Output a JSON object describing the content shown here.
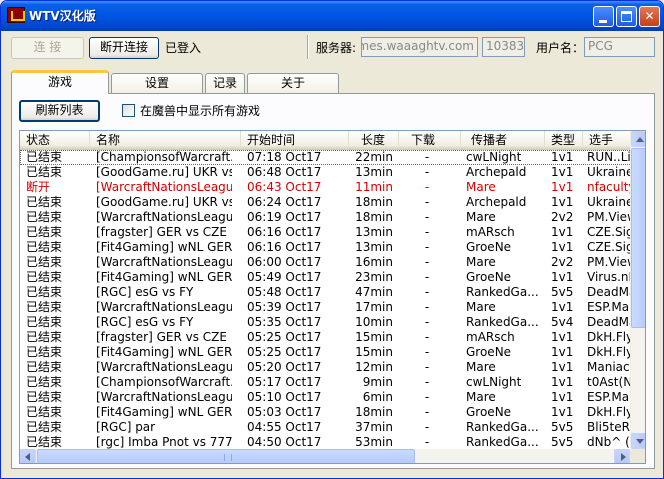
{
  "window": {
    "title": "WTV汉化版"
  },
  "toolbar": {
    "connect_label": "连 接",
    "disconnect_label": "断开连接",
    "status_text": "已登入",
    "server_label": "服务器:",
    "server_value": "games.waaaghtv.com",
    "port_value": "10383",
    "username_label": "用户名：",
    "username_value": "PCG"
  },
  "tabs": [
    {
      "label": "游戏"
    },
    {
      "label": "设置"
    },
    {
      "label": "记录"
    },
    {
      "label": "关于"
    }
  ],
  "games_tab": {
    "refresh_label": "刷新列表",
    "show_all_label": "在魔兽中显示所有游戏",
    "show_all_checked": false
  },
  "table": {
    "columns": [
      "状态",
      "名称",
      "开始时间",
      "长度",
      "下载",
      "传播者",
      "类型",
      "选手"
    ],
    "rows": [
      {
        "status": "已结束",
        "name": "[ChampionsofWarcraft...",
        "time": "07:18 Oct17",
        "length": "22min",
        "download": "-",
        "caster": "cwLNight",
        "type": "1v1",
        "players": "RUN..Lin",
        "selected": true,
        "red": false
      },
      {
        "status": "已结束",
        "name": "[GoodGame.ru] UKR vs...",
        "time": "06:48 Oct17",
        "length": "13min",
        "download": "-",
        "caster": "Archepald",
        "type": "1v1",
        "players": "Ukraine.",
        "selected": false,
        "red": false
      },
      {
        "status": "断开",
        "name": "[WarcraftNationsLeagu...",
        "time": "06:43 Oct17",
        "length": "11min",
        "download": "-",
        "caster": "Mare",
        "type": "1v1",
        "players": "nfaculty",
        "selected": false,
        "red": true
      },
      {
        "status": "已结束",
        "name": "[GoodGame.ru] UKR vs...",
        "time": "06:24 Oct17",
        "length": "18min",
        "download": "-",
        "caster": "Archepald",
        "type": "1v1",
        "players": "Ukraine.",
        "selected": false,
        "red": false
      },
      {
        "status": "已结束",
        "name": "[WarcraftNationsLeagu...",
        "time": "06:19 Oct17",
        "length": "18min",
        "download": "-",
        "caster": "Mare",
        "type": "2v2",
        "players": "PM.View",
        "selected": false,
        "red": false
      },
      {
        "status": "已结束",
        "name": "[fragster] GER vs CZE",
        "time": "06:16 Oct17",
        "length": "13min",
        "download": "-",
        "caster": "mARsch",
        "type": "1v1",
        "players": "CZE.Sign",
        "selected": false,
        "red": false
      },
      {
        "status": "已结束",
        "name": "[Fit4Gaming] wNL GER...",
        "time": "06:16 Oct17",
        "length": "13min",
        "download": "-",
        "caster": "GroeNe",
        "type": "1v1",
        "players": "CZE.Sign",
        "selected": false,
        "red": false
      },
      {
        "status": "已结束",
        "name": "[WarcraftNationsLeagu...",
        "time": "06:00 Oct17",
        "length": "16min",
        "download": "-",
        "caster": "Mare",
        "type": "2v2",
        "players": "PM.View",
        "selected": false,
        "red": false
      },
      {
        "status": "已结束",
        "name": "[Fit4Gaming] wNL GER...",
        "time": "05:49 Oct17",
        "length": "23min",
        "download": "-",
        "caster": "GroeNe",
        "type": "1v1",
        "players": "Virus.nE",
        "selected": false,
        "red": false
      },
      {
        "status": "已结束",
        "name": "[RGC] esG vs FY",
        "time": "05:48 Oct17",
        "length": "47min",
        "download": "-",
        "caster": "RankedGa...",
        "type": "5v5",
        "players": "DeadMa",
        "selected": false,
        "red": false
      },
      {
        "status": "已结束",
        "name": "[WarcraftNationsLeagu...",
        "time": "05:39 Oct17",
        "length": "17min",
        "download": "-",
        "caster": "Mare",
        "type": "1v1",
        "players": "ESP.Ma",
        "selected": false,
        "red": false
      },
      {
        "status": "已结束",
        "name": "[RGC] esG vs FY",
        "time": "05:35 Oct17",
        "length": "10min",
        "download": "-",
        "caster": "RankedGa...",
        "type": "5v4",
        "players": "DeadMa",
        "selected": false,
        "red": false
      },
      {
        "status": "已结束",
        "name": "[fragster] GER vs CZE",
        "time": "05:25 Oct17",
        "length": "15min",
        "download": "-",
        "caster": "mARsch",
        "type": "1v1",
        "players": "DkH.Fly",
        "selected": false,
        "red": false
      },
      {
        "status": "已结束",
        "name": "[Fit4Gaming] wNL GER...",
        "time": "05:25 Oct17",
        "length": "15min",
        "download": "-",
        "caster": "GroeNe",
        "type": "1v1",
        "players": "DkH.Fly",
        "selected": false,
        "red": false
      },
      {
        "status": "已结束",
        "name": "[WarcraftNationsLeagu...",
        "time": "05:20 Oct17",
        "length": "12min",
        "download": "-",
        "caster": "Mare",
        "type": "1v1",
        "players": "Maniac-",
        "selected": false,
        "red": false
      },
      {
        "status": "已结束",
        "name": "[ChampionsofWarcraft...",
        "time": "05:17 Oct17",
        "length": "9min",
        "download": "-",
        "caster": "cwLNight",
        "type": "1v1",
        "players": "t0Ast(N",
        "selected": false,
        "red": false
      },
      {
        "status": "已结束",
        "name": "[WarcraftNationsLeagu...",
        "time": "05:10 Oct17",
        "length": "6min",
        "download": "-",
        "caster": "Mare",
        "type": "1v1",
        "players": "ESP.Ma",
        "selected": false,
        "red": false
      },
      {
        "status": "已结束",
        "name": "[Fit4Gaming] wNL GER...",
        "time": "05:03 Oct17",
        "length": "18min",
        "download": "-",
        "caster": "GroeNe",
        "type": "1v1",
        "players": "DkH.Fly",
        "selected": false,
        "red": false
      },
      {
        "status": "已结束",
        "name": "[RGC] par",
        "time": "04:55 Oct17",
        "length": "37min",
        "download": "-",
        "caster": "RankedGa...",
        "type": "5v5",
        "players": "Bli5teR",
        "selected": false,
        "red": false
      },
      {
        "status": "已结束",
        "name": "[rgc] Imba Pnot vs 777",
        "time": "04:50 Oct17",
        "length": "53min",
        "download": "-",
        "caster": "RankedGa...",
        "type": "5v5",
        "players": "dNb^ (",
        "selected": false,
        "red": false
      }
    ]
  },
  "colors": {
    "titlebar": "#0055e5",
    "selection_outline": "#666666",
    "disconnected_text": "#d40000",
    "active_tab_accent": "#ffc83c"
  }
}
